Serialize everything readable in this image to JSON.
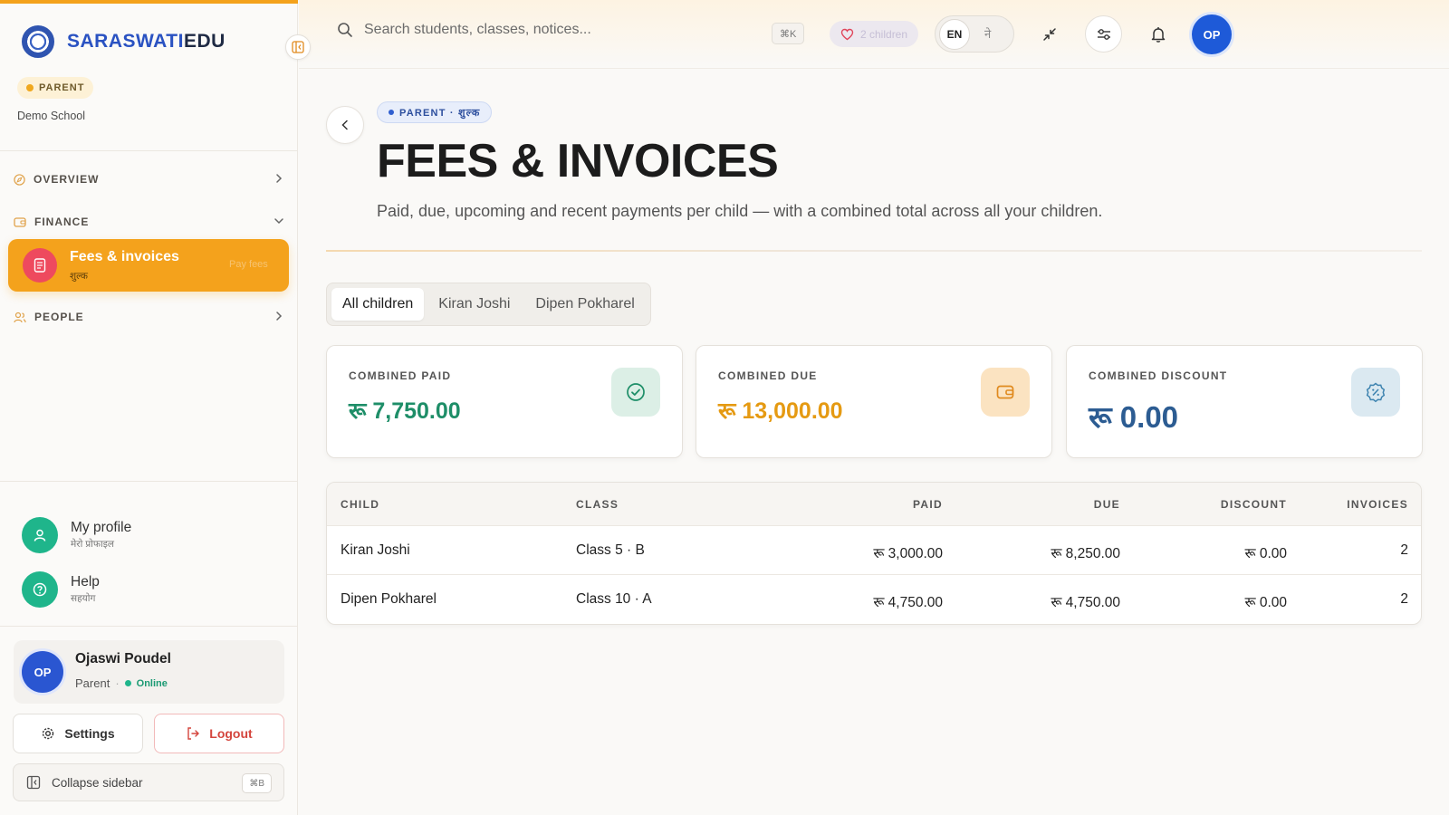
{
  "brand": {
    "name_a": "SARASWATI",
    "name_b": "EDU"
  },
  "sidebar": {
    "role": "PARENT",
    "school": "Demo School",
    "sections": [
      {
        "label": "OVERVIEW"
      },
      {
        "label": "FINANCE"
      },
      {
        "label": "PEOPLE"
      }
    ],
    "active_item": {
      "label": "Fees & invoices",
      "sublabel": "शुल्क",
      "hint": "Pay fees"
    },
    "links": [
      {
        "label": "My profile",
        "sublabel": "मेरो प्रोफाइल"
      },
      {
        "label": "Help",
        "sublabel": "सहयोग"
      }
    ],
    "user": {
      "initials": "OP",
      "name": "Ojaswi Poudel",
      "role": "Parent",
      "status": "Online"
    },
    "settings_label": "Settings",
    "logout_label": "Logout",
    "collapse_label": "Collapse sidebar",
    "collapse_shortcut": "⌘B"
  },
  "topbar": {
    "search_placeholder": "Search students, classes, notices...",
    "search_shortcut": "⌘K",
    "children_pill": "2 children",
    "lang_en": "EN",
    "lang_ne": "ने",
    "avatar_initials": "OP"
  },
  "page": {
    "crumb": "PARENT · शुल्क",
    "title": "FEES & INVOICES",
    "subtitle": "Paid, due, upcoming and recent payments per child — with a combined total across all your children."
  },
  "tabs": [
    "All children",
    "Kiran Joshi",
    "Dipen Pokharel"
  ],
  "cards": [
    {
      "label": "COMBINED PAID",
      "value": "रू 7,750.00",
      "color": "#1e8e68"
    },
    {
      "label": "COMBINED DUE",
      "value": "रू 13,000.00",
      "color": "#e59a12"
    },
    {
      "label": "COMBINED DISCOUNT",
      "value": "रू 0.00",
      "color": "#2c5c92"
    }
  ],
  "table": {
    "headers": {
      "child": "CHILD",
      "class": "CLASS",
      "paid": "PAID",
      "due": "DUE",
      "discount": "DISCOUNT",
      "invoices": "INVOICES"
    },
    "rows": [
      {
        "child": "Kiran Joshi",
        "class": "Class 5 · B",
        "paid": "रू 3,000.00",
        "due": "रू 8,250.00",
        "discount": "रू 0.00",
        "invoices": "2"
      },
      {
        "child": "Dipen Pokharel",
        "class": "Class 10 · A",
        "paid": "रू 4,750.00",
        "due": "रू 4,750.00",
        "discount": "रू 0.00",
        "invoices": "2"
      }
    ]
  }
}
